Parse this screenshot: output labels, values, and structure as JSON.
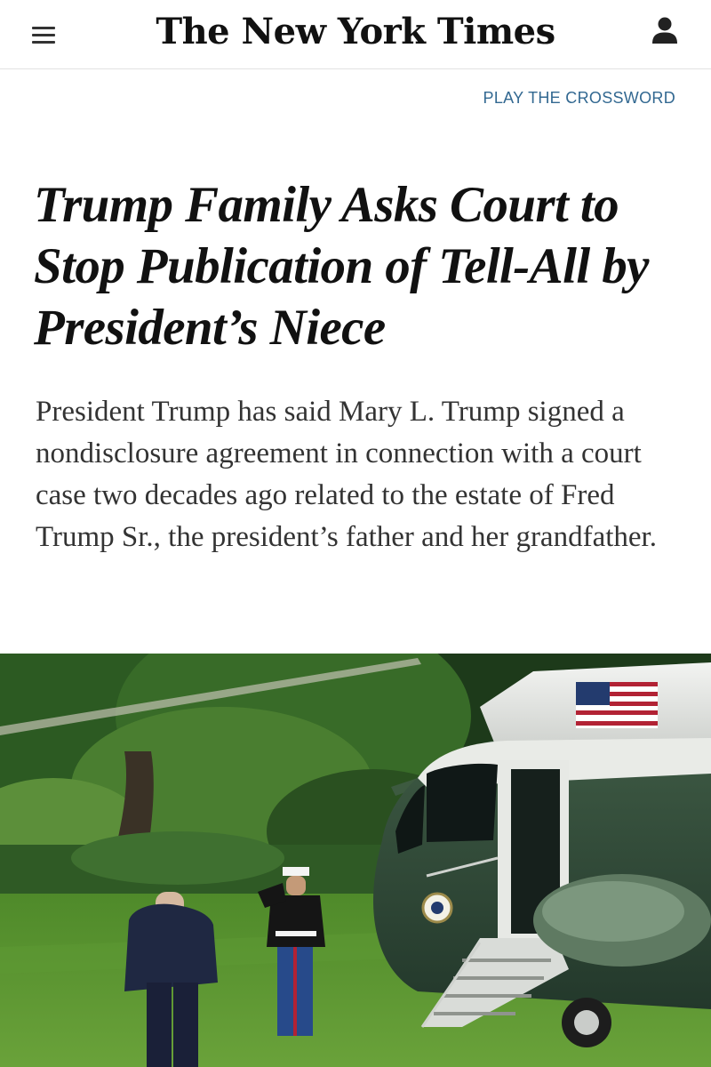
{
  "header": {
    "menu_icon": "hamburger-menu-icon",
    "logo_text": "The New York Times",
    "account_icon": "person-icon"
  },
  "links": {
    "crossword": "PLAY THE CROSSWORD"
  },
  "article": {
    "headline": "Trump Family Asks Court to Stop Publication of Tell-All by President’s Niece",
    "summary": "President Trump has said Mary L. Trump signed a nondisclosure agreement in connection with a court case two decades ago related to the estate of Fred Trump Sr., the president’s father and her grandfather."
  },
  "colors": {
    "link": "#326891",
    "text": "#121212",
    "summary_text": "#333333"
  }
}
